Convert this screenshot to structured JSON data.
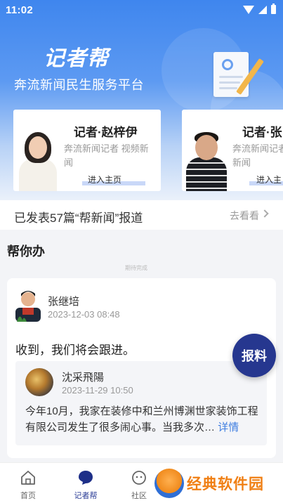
{
  "status_bar": {
    "time": "11:02"
  },
  "hero": {
    "brand": "记者帮",
    "subtitle": "奔流新闻民生服务平台"
  },
  "reporters": [
    {
      "name": "记者·赵梓伊",
      "desc": "奔流新闻记者 视频新闻",
      "home": "进入主页"
    },
    {
      "name": "记者·张",
      "desc": "奔流新闻记者",
      "desc2": "新闻",
      "home": "进入主"
    }
  ],
  "published": {
    "text": "已发表57篇“帮新闻”报道",
    "more": "去看看"
  },
  "section": {
    "title": "帮你办",
    "tiny_label": "期待完成"
  },
  "post": {
    "user": "张继培",
    "time": "2023-12-03 08:48",
    "reply": "收到，我们将会跟进。",
    "quote": {
      "user": "沈采飛陽",
      "time": "2023-11-29 10:50",
      "text": "今年10月，我家在装修中和兰州博渊世家装饰工程有限公司发生了很多闹心事。当我多次…",
      "more": "详情"
    }
  },
  "report_button": "报料",
  "tabs": [
    {
      "label": "首页",
      "icon": "home-icon"
    },
    {
      "label": "记者帮",
      "icon": "chat-bubble-icon"
    },
    {
      "label": "社区",
      "icon": "community-icon"
    }
  ],
  "watermark": {
    "text": "经典软件园"
  },
  "colors": {
    "primary": "#3f86ee",
    "accent": "#26378f",
    "watermark": "#f07f14"
  }
}
